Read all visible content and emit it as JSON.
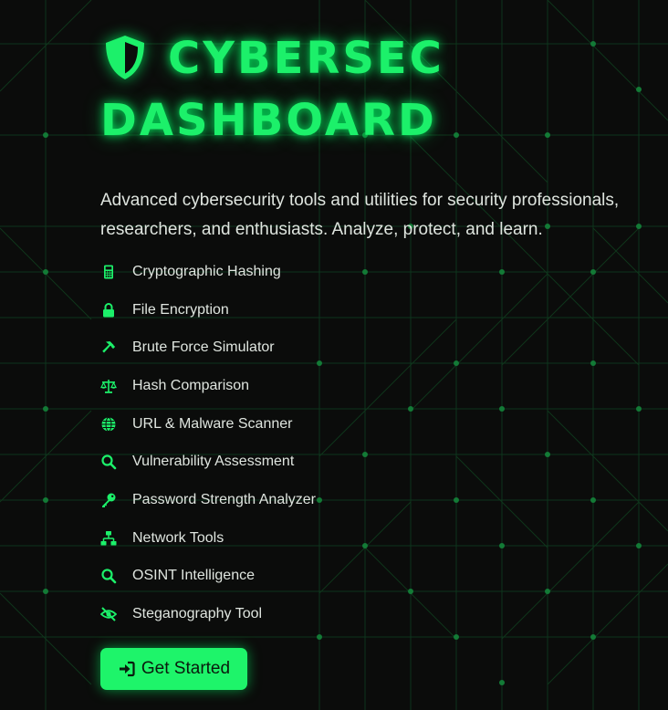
{
  "header": {
    "logo_icon": "shield-icon",
    "title_line1": "CYBERSEC",
    "title_line2": "DASHBOARD",
    "subtitle": "Advanced cybersecurity tools and utilities for security professionals, researchers, and enthusiasts. Analyze, protect, and learn."
  },
  "features": [
    {
      "label": "Cryptographic Hashing",
      "icon": "calculator-icon"
    },
    {
      "label": "File Encryption",
      "icon": "lock-icon"
    },
    {
      "label": "Brute Force Simulator",
      "icon": "hammer-icon"
    },
    {
      "label": "Hash Comparison",
      "icon": "scale-icon"
    },
    {
      "label": "URL & Malware Scanner",
      "icon": "globe-icon"
    },
    {
      "label": "Vulnerability Assessment",
      "icon": "search-icon"
    },
    {
      "label": "Password Strength Analyzer",
      "icon": "key-icon"
    },
    {
      "label": "Network Tools",
      "icon": "network-icon"
    },
    {
      "label": "OSINT Intelligence",
      "icon": "search-icon"
    },
    {
      "label": "Steganography Tool",
      "icon": "eye-slash-icon"
    }
  ],
  "cta": {
    "label": "Get Started",
    "icon": "sign-in-icon"
  },
  "colors": {
    "accent": "#1cf06a",
    "background": "#0b0c0b",
    "text": "#dfe5df",
    "button_text": "#0a1a0d"
  }
}
